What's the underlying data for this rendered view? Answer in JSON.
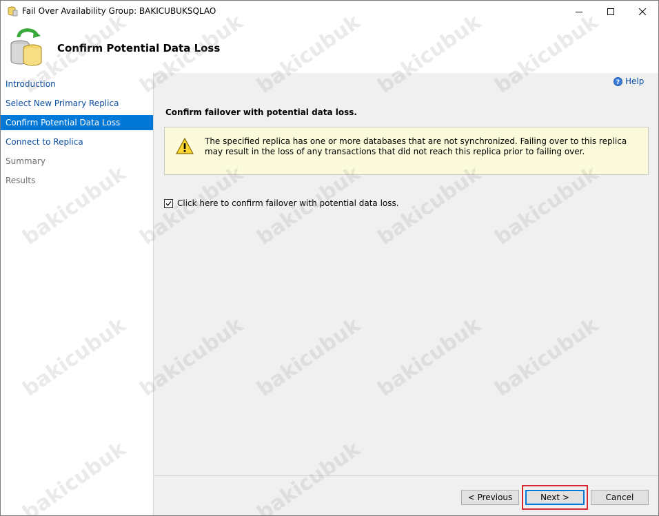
{
  "window": {
    "title": "Fail Over Availability Group: BAKICUBUKSQLAO",
    "controls": {
      "minimize": "minimize",
      "maximize": "maximize",
      "close": "close"
    }
  },
  "header": {
    "title": "Confirm Potential Data Loss"
  },
  "sidebar": {
    "items": [
      {
        "label": "Introduction",
        "state": "link"
      },
      {
        "label": "Select New Primary Replica",
        "state": "link"
      },
      {
        "label": "Confirm Potential Data Loss",
        "state": "active"
      },
      {
        "label": "Connect to Replica",
        "state": "link"
      },
      {
        "label": "Summary",
        "state": "disabled"
      },
      {
        "label": "Results",
        "state": "disabled"
      }
    ]
  },
  "content": {
    "help_label": "Help",
    "section_title": "Confirm failover with potential data loss.",
    "warning_text": "The specified replica has one or more databases that are not synchronized. Failing over to this replica may result in the loss of any transactions that did not reach this replica prior to failing over.",
    "confirm_checkbox": {
      "label": "Click here to confirm failover with potential data loss.",
      "checked": true
    }
  },
  "buttons": {
    "previous": "< Previous",
    "next": "Next >",
    "cancel": "Cancel"
  },
  "watermark": "bakicubuk",
  "colors": {
    "accent": "#0078d7",
    "link": "#0c4ea2",
    "warning_bg": "#fbfbdb",
    "highlight": "#d6262d"
  }
}
